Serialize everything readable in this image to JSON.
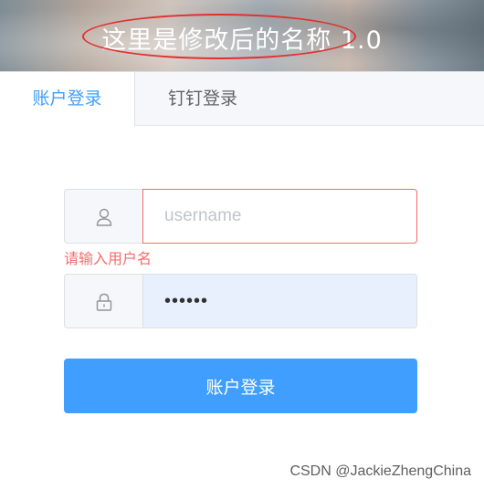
{
  "header": {
    "title": "这里是修改后的名称 1.0"
  },
  "tabs": [
    {
      "label": "账户登录",
      "active": true
    },
    {
      "label": "钉钉登录",
      "active": false
    }
  ],
  "form": {
    "username": {
      "icon": "user-icon",
      "placeholder": "username",
      "value": "",
      "error": "请输入用户名"
    },
    "password": {
      "icon": "lock-icon",
      "value": "••••••"
    },
    "submit_label": "账户登录"
  },
  "watermark": "CSDN @JackieZhengChina",
  "colors": {
    "accent": "#409eff",
    "error": "#f56c6c",
    "highlight_ellipse": "#e0312f"
  }
}
